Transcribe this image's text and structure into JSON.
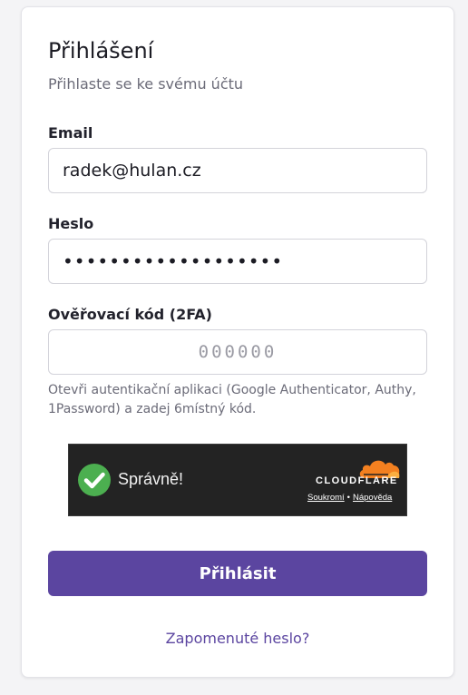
{
  "login": {
    "title": "Přihlášení",
    "subtitle": "Přihlaste se ke svému účtu",
    "email": {
      "label": "Email",
      "value": "radek@hulan.cz"
    },
    "password": {
      "label": "Heslo",
      "value": "•••••••••••••••••••"
    },
    "twofa": {
      "label": "Ověřovací kód (2FA)",
      "placeholder": "000000",
      "value": "",
      "hint": "Otevři autentikační aplikaci (Google Authenticator, Authy, 1Password) a zadej 6místný kód."
    },
    "turnstile": {
      "status": "Správně!",
      "brand": "CLOUDFLARE",
      "privacy_link": "Soukromí",
      "separator": "•",
      "help_link": "Nápověda",
      "colors": {
        "background": "#232323",
        "check": "#4caf50",
        "logo": "#f38020"
      },
      "icons": [
        "check-circle-icon",
        "cloudflare-cloud-icon"
      ]
    },
    "submit_label": "Přihlásit",
    "forgot_label": "Zapomenuté heslo?",
    "colors": {
      "accent": "#5b45a0"
    }
  }
}
